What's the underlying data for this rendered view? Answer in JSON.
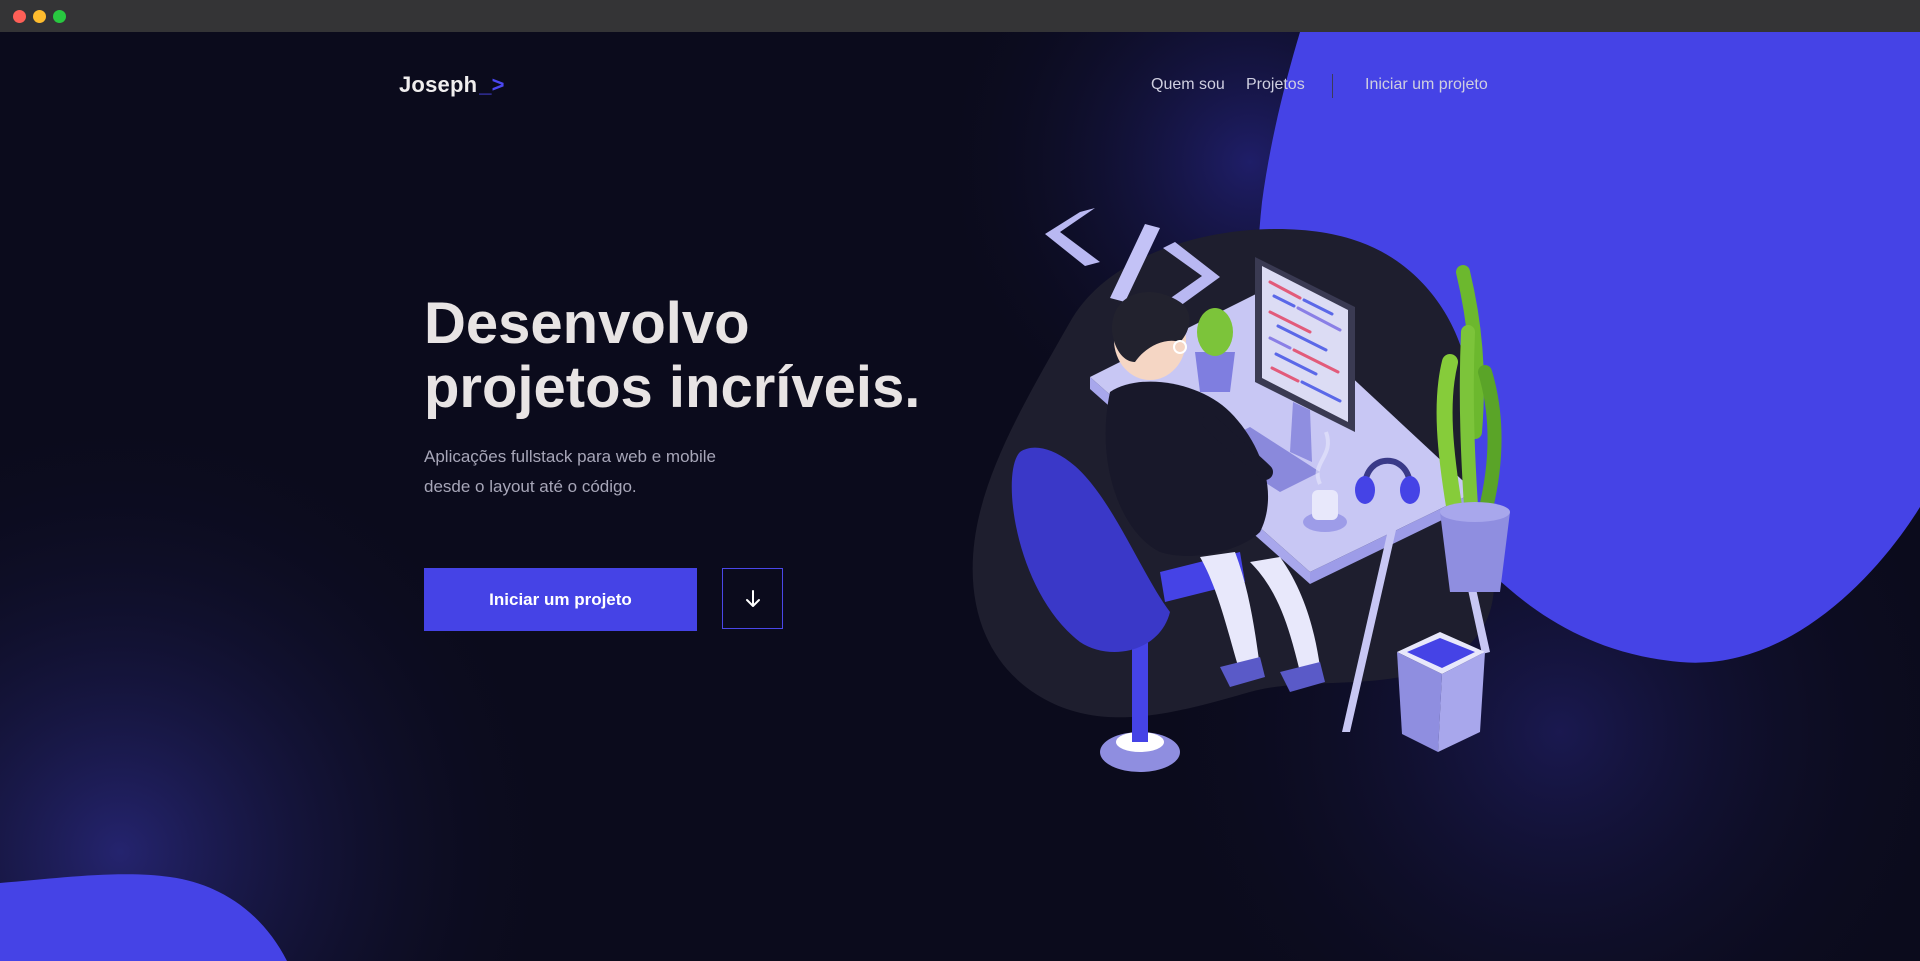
{
  "window": {
    "controls": [
      "close",
      "minimize",
      "maximize"
    ]
  },
  "brand": {
    "name": "Joseph",
    "accent": "_>",
    "accent_color": "#4543e6"
  },
  "nav": {
    "items": [
      "Quem sou",
      "Projetos"
    ],
    "cta": "Iniciar um projeto"
  },
  "hero": {
    "title_line1": "Desenvolvo",
    "title_line2": "projetos incríveis.",
    "subtitle_line1": "Aplicações fullstack para web e mobile",
    "subtitle_line2": "desde o layout até o código.",
    "primary_button": "Iniciar um projeto",
    "scroll_icon": "arrow-down-icon"
  },
  "colors": {
    "background": "#0b0b1c",
    "accent": "#4543e6",
    "text": "#e8e4e4",
    "muted": "#a7a6b8"
  },
  "illustration": {
    "subject": "developer-at-desk",
    "code_symbol": "</>"
  }
}
